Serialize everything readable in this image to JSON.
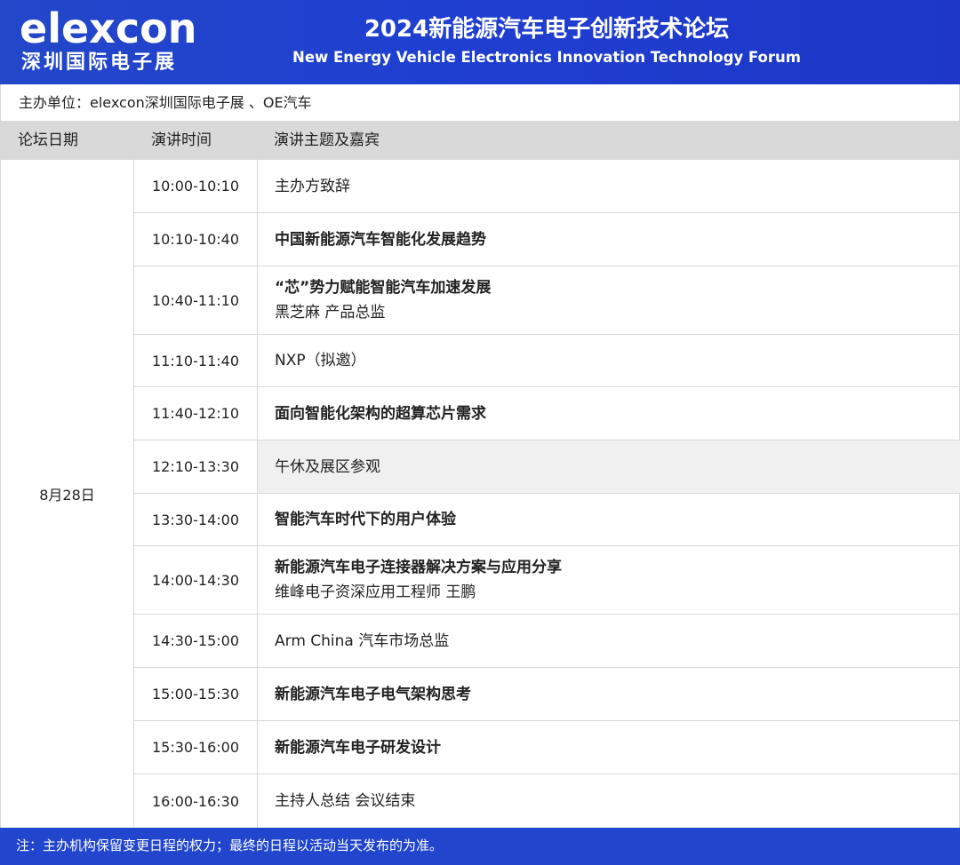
{
  "header": {
    "logo_en": "elexcon",
    "logo_cn": "深圳国际电子展",
    "title_cn": "2024新能源汽车电子创新技术论坛",
    "title_en": "New Energy Vehicle Electronics Innovation Technology Forum"
  },
  "organizer": "主办单位：elexcon深圳国际电子展 、OE汽车",
  "columns": {
    "date": "论坛日期",
    "time": "演讲时间",
    "topic": "演讲主题及嘉宾"
  },
  "date": "8月28日",
  "rows": [
    {
      "time": "10:00-10:10",
      "topic": "主办方致辞",
      "speaker": ""
    },
    {
      "time": "10:10-10:40",
      "topic": "中国新能源汽车智能化发展趋势",
      "speaker": ""
    },
    {
      "time": "10:40-11:10",
      "topic": "“芯”势力赋能智能汽车加速发展",
      "speaker": "黑芝麻 产品总监"
    },
    {
      "time": "11:10-11:40",
      "topic": "NXP（拟邀）",
      "speaker": ""
    },
    {
      "time": "11:40-12:10",
      "topic": "面向智能化架构的超算芯片需求",
      "speaker": ""
    },
    {
      "time": "12:10-13:30",
      "topic": "午休及展区参观",
      "speaker": ""
    },
    {
      "time": "13:30-14:00",
      "topic": "智能汽车时代下的用户体验",
      "speaker": ""
    },
    {
      "time": "14:00-14:30",
      "topic": "新能源汽车电子连接器解决方案与应用分享",
      "speaker": "维峰电子资深应用工程师 王鹏"
    },
    {
      "time": "14:30-15:00",
      "topic": "Arm China 汽车市场总监",
      "speaker": ""
    },
    {
      "time": "15:00-15:30",
      "topic": "新能源汽车电子电气架构思考",
      "speaker": ""
    },
    {
      "time": "15:30-16:00",
      "topic": "新能源汽车电子研发设计",
      "speaker": ""
    },
    {
      "time": "16:00-16:30",
      "topic": "主持人总结 会议结束",
      "speaker": ""
    }
  ],
  "footer": "注：主办机构保留变更日程的权力；最终的日程以活动当天发布的为准。"
}
